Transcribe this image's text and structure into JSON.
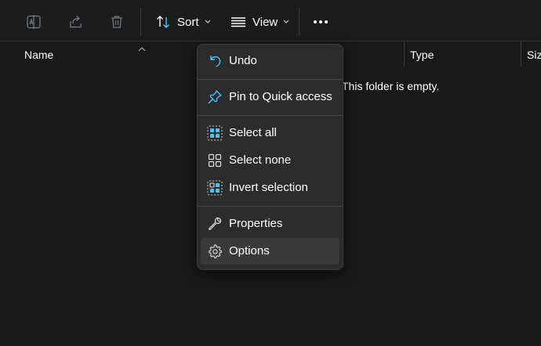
{
  "toolbar": {
    "rename_icon": "rename-icon",
    "share_icon": "share-icon",
    "delete_icon": "trash-icon",
    "sort_label": "Sort",
    "view_label": "View",
    "more_icon": "more-icon"
  },
  "columns": {
    "name": "Name",
    "type": "Type",
    "size": "Size"
  },
  "empty_message": "This folder is empty.",
  "context_menu": {
    "items": [
      {
        "label": "Undo",
        "icon": "undo-icon"
      },
      {
        "label": "Pin to Quick access",
        "icon": "pin-icon"
      },
      {
        "label": "Select all",
        "icon": "select-all-icon"
      },
      {
        "label": "Select none",
        "icon": "select-none-icon"
      },
      {
        "label": "Invert selection",
        "icon": "invert-selection-icon"
      },
      {
        "label": "Properties",
        "icon": "wrench-icon"
      },
      {
        "label": "Options",
        "icon": "gear-icon"
      }
    ],
    "highlighted_item": "Options"
  },
  "colors": {
    "background": "#191919",
    "menu_background": "#2c2c2c",
    "accent": "#4cc2ff",
    "disabled_icon": "#6f7a84"
  }
}
